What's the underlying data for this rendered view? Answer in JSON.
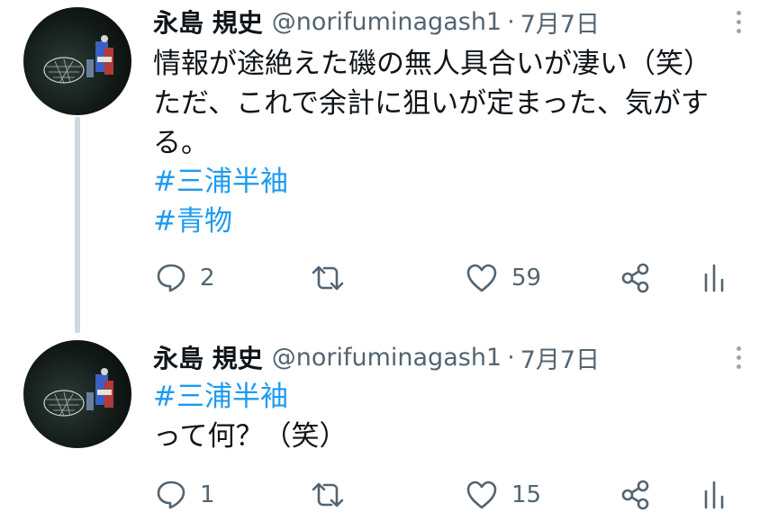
{
  "tweets": [
    {
      "author_name": "永島 規史",
      "handle": "@norifuminagash1",
      "separator": "·",
      "date": "7月7日",
      "lines": [
        {
          "text": "情報が途絶えた磯の無人具合いが凄い（笑）",
          "type": "text"
        },
        {
          "text": "ただ、これで余計に狙いが定まった、気がす",
          "type": "text"
        },
        {
          "text": "る。",
          "type": "text"
        },
        {
          "text": "#三浦半袖",
          "type": "hashtag"
        },
        {
          "text": "#青物",
          "type": "hashtag"
        }
      ],
      "reply_count": "2",
      "retweet_count": "",
      "like_count": "59"
    },
    {
      "author_name": "永島 規史",
      "handle": "@norifuminagash1",
      "separator": "·",
      "date": "7月7日",
      "lines": [
        {
          "text": "#三浦半袖",
          "type": "hashtag"
        },
        {
          "text": "って何？（笑）",
          "type": "text"
        }
      ],
      "reply_count": "1",
      "retweet_count": "",
      "like_count": "15"
    }
  ],
  "icons": {
    "reply": "reply-icon",
    "retweet": "retweet-icon",
    "like": "heart-icon",
    "share": "share-icon",
    "analytics": "analytics-icon",
    "more": "more-icon"
  },
  "colors": {
    "hashtag": "#1d9bf0",
    "secondary_text": "#536471",
    "thread_line": "#cfd9de"
  }
}
